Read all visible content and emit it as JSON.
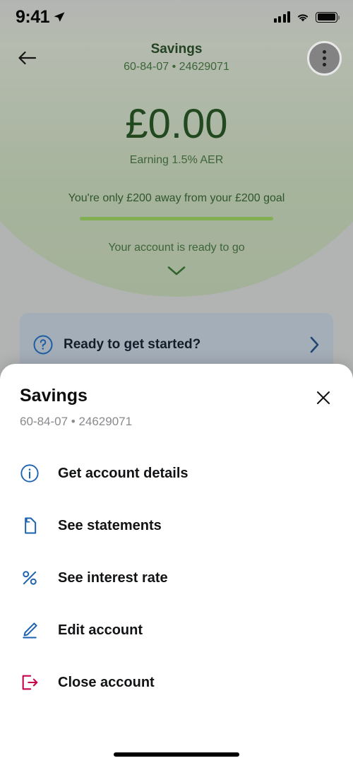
{
  "status_bar": {
    "time": "9:41",
    "location_icon": "location-arrow-icon",
    "signal_icon": "cellular-signal-icon",
    "wifi_icon": "wifi-icon",
    "battery_icon": "battery-icon"
  },
  "navbar": {
    "back_icon": "back-arrow-icon",
    "title": "Savings",
    "subtitle": "60-84-07 • 24629071",
    "menu_icon": "more-options-icon"
  },
  "account": {
    "balance": "£0.00",
    "earning": "Earning 1.5% AER"
  },
  "goal": {
    "text": "You're only £200 away from your £200 goal",
    "progress_percent": 100,
    "ready_text": "Your account is ready to go",
    "expand_icon": "chevron-down-icon"
  },
  "info_card": {
    "icon": "question-circle-icon",
    "label": "Ready to get started?",
    "chevron": "chevron-right-icon"
  },
  "sheet": {
    "title": "Savings",
    "subtitle": "60-84-07 • 24629071",
    "close_icon": "close-icon",
    "menu": [
      {
        "icon": "info-circle-icon",
        "label": "Get account details",
        "color": "#1b62b0"
      },
      {
        "icon": "document-icon",
        "label": "See statements",
        "color": "#1b62b0"
      },
      {
        "icon": "percent-icon",
        "label": "See interest rate",
        "color": "#1b62b0"
      },
      {
        "icon": "pencil-icon",
        "label": "Edit account",
        "color": "#1b62b0"
      },
      {
        "icon": "exit-icon",
        "label": "Close account",
        "color": "#c8004b"
      }
    ]
  },
  "colors": {
    "brand_green_dark": "#1e4a1c",
    "brand_green": "#3d6b38",
    "progress_green": "#8cc055",
    "action_blue": "#1b62b0",
    "danger_crimson": "#c8004b",
    "background_gray": "#c3c5c4",
    "card_blue_gray": "#b3bfca"
  },
  "home_indicator": "home-indicator"
}
